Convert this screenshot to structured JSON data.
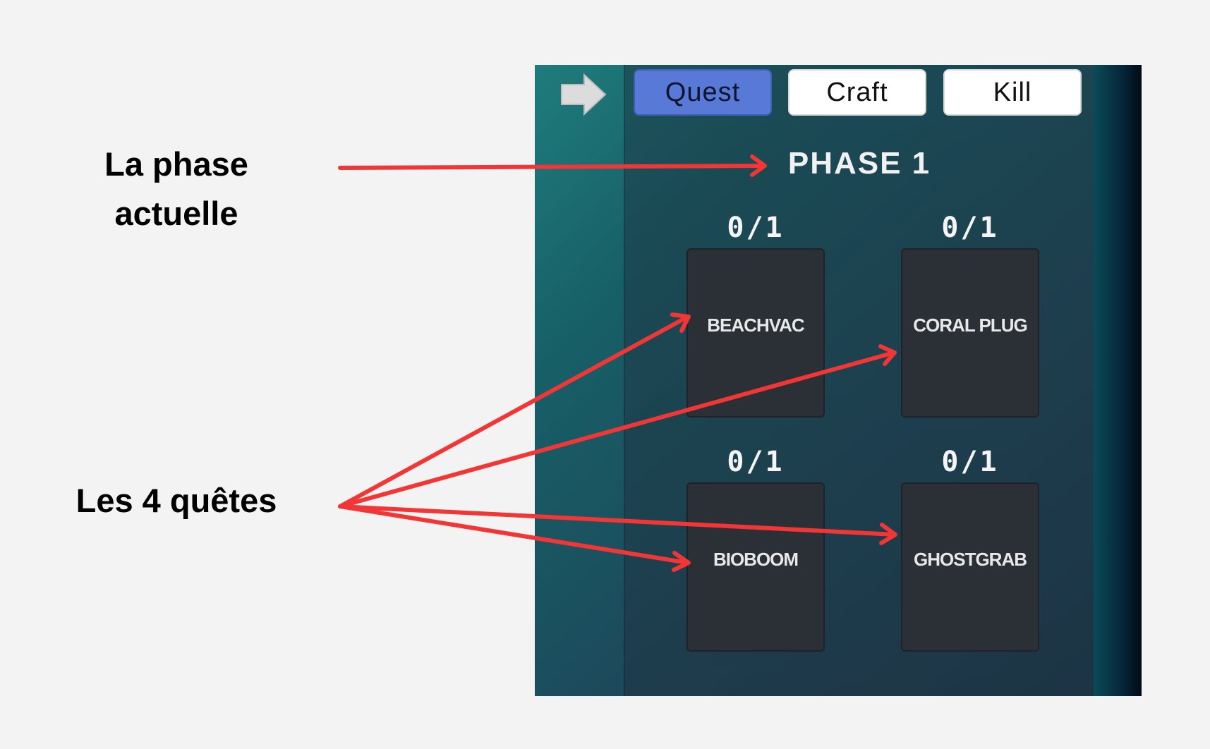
{
  "annotations": {
    "phase_label": "La phase actuelle",
    "quests_label": "Les 4 quêtes",
    "arrow_color": "#f23535"
  },
  "toolbar": {
    "arrow_icon": "arrow-right-icon",
    "tabs": [
      {
        "label": "Quest",
        "active": true
      },
      {
        "label": "Craft",
        "active": false
      },
      {
        "label": "Kill",
        "active": false
      }
    ]
  },
  "phase": {
    "title": "PHASE 1"
  },
  "quests": [
    {
      "name": "BEACHVAC",
      "progress": "0/1"
    },
    {
      "name": "CORAL PLUG",
      "progress": "0/1"
    },
    {
      "name": "BIOBOOM",
      "progress": "0/1"
    },
    {
      "name": "GHOSTGRAB",
      "progress": "0/1"
    }
  ],
  "colors": {
    "active_tab": "#5879d6",
    "card_bg": "#2b3036",
    "panel_teal": "#1f7c7c"
  }
}
